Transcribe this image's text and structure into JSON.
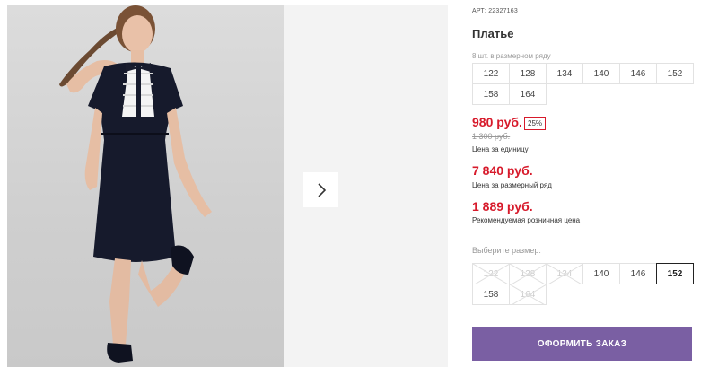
{
  "gallery": {
    "next_icon": "chevron-right-icon"
  },
  "product": {
    "article_label": "АРТ:",
    "article_number": "22327163",
    "title": "Платье",
    "range_label": "8 шт. в размерном ряду",
    "range_sizes": [
      "122",
      "128",
      "134",
      "140",
      "146",
      "152",
      "158",
      "164"
    ],
    "unit_price": "980 руб.",
    "discount": "25%",
    "old_price": "1 300 руб.",
    "unit_price_caption": "Цена за единицу",
    "range_price": "7 840 руб.",
    "range_price_caption": "Цена за размерный ряд",
    "retail_price": "1 889 руб.",
    "retail_price_caption": "Рекомендуемая розничная цена",
    "choose_size_label": "Выберите размер:",
    "select_sizes": [
      {
        "label": "122",
        "available": false,
        "selected": false
      },
      {
        "label": "128",
        "available": false,
        "selected": false
      },
      {
        "label": "134",
        "available": false,
        "selected": false
      },
      {
        "label": "140",
        "available": true,
        "selected": false
      },
      {
        "label": "146",
        "available": true,
        "selected": false
      },
      {
        "label": "152",
        "available": true,
        "selected": true
      },
      {
        "label": "158",
        "available": true,
        "selected": false
      },
      {
        "label": "164",
        "available": false,
        "selected": false
      }
    ],
    "order_button": "ОФОРМИТЬ ЗАКАЗ"
  },
  "colors": {
    "price_red": "#d71a2b",
    "order_button": "#7a5fa3"
  }
}
